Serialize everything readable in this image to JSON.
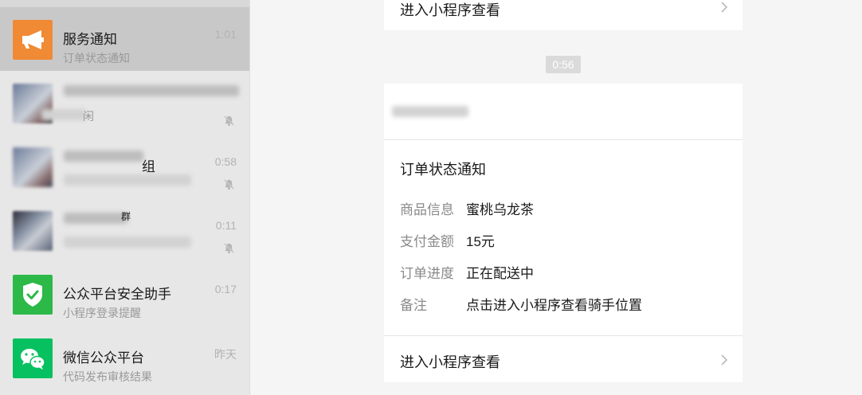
{
  "sidebar": {
    "chats": [
      {
        "name": "服务通知",
        "preview": "订单状态通知",
        "time": "1:01",
        "icon": "megaphone-icon",
        "avatar_color": "#f08a35"
      },
      {
        "name": "",
        "preview": "闲",
        "time": "",
        "icon": "group-avatar",
        "muted": true
      },
      {
        "name": "组",
        "preview": "",
        "time": "0:58",
        "icon": "group-avatar",
        "muted": true
      },
      {
        "name": "群",
        "preview": "",
        "time": "0:11",
        "icon": "group-avatar",
        "muted": true
      },
      {
        "name": "公众平台安全助手",
        "preview": "小程序登录提醒",
        "time": "0:17",
        "icon": "shield-check-icon",
        "avatar_color": "#2cb948"
      },
      {
        "name": "微信公众平台",
        "preview": "代码发布审核结果",
        "time": "昨天",
        "icon": "wechat-icon",
        "avatar_color": "#07c160"
      }
    ]
  },
  "chat": {
    "top_card": {
      "link": "进入小程序查看"
    },
    "timestamp": "0:56",
    "message": {
      "title": "订单状态通知",
      "rows": [
        {
          "label": "商品信息",
          "value": "蜜桃乌龙茶"
        },
        {
          "label": "支付金额",
          "value": "15元"
        },
        {
          "label": "订单进度",
          "value": "正在配送中"
        },
        {
          "label": "备注",
          "value": "点击进入小程序查看骑手位置"
        }
      ],
      "link": "进入小程序查看"
    }
  }
}
